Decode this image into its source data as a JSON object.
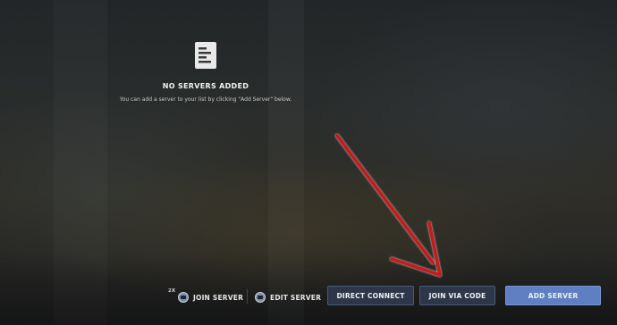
{
  "empty_state": {
    "icon": "document-icon",
    "title": "NO SERVERS ADDED",
    "subtitle": "You can add a server to your list by clicking \"Add Server\" below."
  },
  "toolbar": {
    "join_hint_badge": "2X",
    "join_server_label": "JOIN SERVER",
    "edit_server_label": "EDIT SERVER",
    "direct_connect_label": "DIRECT CONNECT",
    "join_via_code_label": "JOIN VIA CODE",
    "add_server_label": "ADD SERVER"
  },
  "colors": {
    "primary_button": "#5f7fc3",
    "secondary_button": "#2d3749",
    "annotation_arrow": "#c41a1a"
  }
}
